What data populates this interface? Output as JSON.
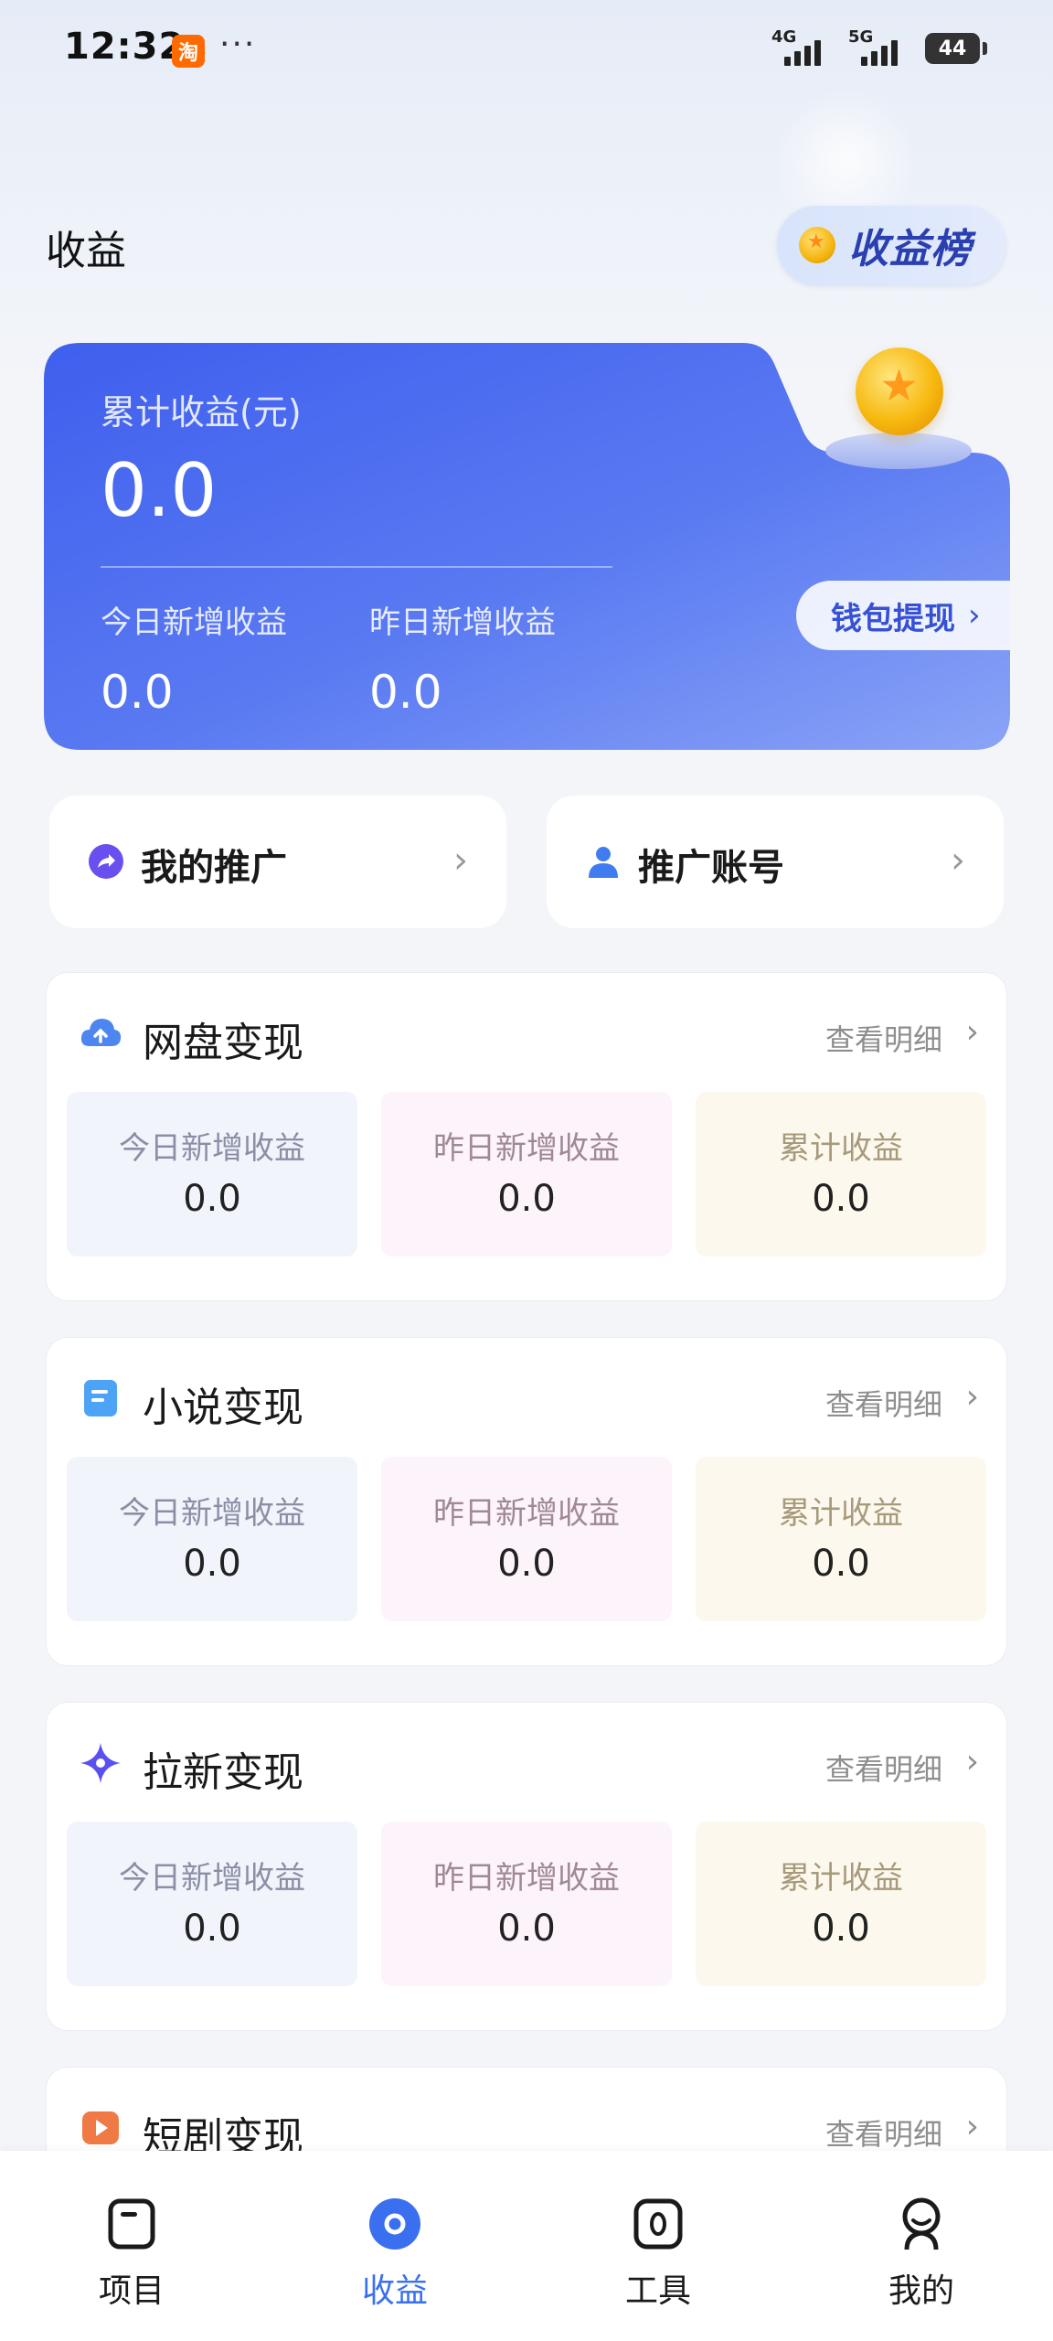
{
  "status_bar": {
    "time": "12:32",
    "app_badge": "淘",
    "dots": "···",
    "network1": "4G",
    "network2": "5G",
    "battery": "44"
  },
  "header": {
    "title": "收益",
    "rank_button": "收益榜"
  },
  "earnings": {
    "total_label": "累计收益(元)",
    "total_value": "0.0",
    "today_label": "今日新增收益",
    "today_value": "0.0",
    "yesterday_label": "昨日新增收益",
    "yesterday_value": "0.0",
    "wallet_button": "钱包提现",
    "card_color": "#4a6cf0"
  },
  "quick_actions": [
    {
      "label": "我的推广",
      "icon": "share-arrow-icon"
    },
    {
      "label": "推广账号",
      "icon": "person-icon"
    }
  ],
  "sections": [
    {
      "title": "网盘变现",
      "icon": "cloud-upload-icon",
      "detail": "查看明细",
      "stats": [
        {
          "label": "今日新增收益",
          "value": "0.0"
        },
        {
          "label": "昨日新增收益",
          "value": "0.0"
        },
        {
          "label": "累计收益",
          "value": "0.0"
        }
      ]
    },
    {
      "title": "小说变现",
      "icon": "book-icon",
      "detail": "查看明细",
      "stats": [
        {
          "label": "今日新增收益",
          "value": "0.0"
        },
        {
          "label": "昨日新增收益",
          "value": "0.0"
        },
        {
          "label": "累计收益",
          "value": "0.0"
        }
      ]
    },
    {
      "title": "拉新变现",
      "icon": "sparkle-icon",
      "detail": "查看明细",
      "stats": [
        {
          "label": "今日新增收益",
          "value": "0.0"
        },
        {
          "label": "昨日新增收益",
          "value": "0.0"
        },
        {
          "label": "累计收益",
          "value": "0.0"
        }
      ]
    },
    {
      "title": "短剧变现",
      "icon": "play-icon",
      "detail": "查看明细"
    }
  ],
  "bottom_nav": [
    {
      "label": "项目",
      "icon": "project-icon",
      "active": false
    },
    {
      "label": "收益",
      "icon": "earnings-icon",
      "active": true
    },
    {
      "label": "工具",
      "icon": "tools-icon",
      "active": false
    },
    {
      "label": "我的",
      "icon": "profile-icon",
      "active": false
    }
  ]
}
